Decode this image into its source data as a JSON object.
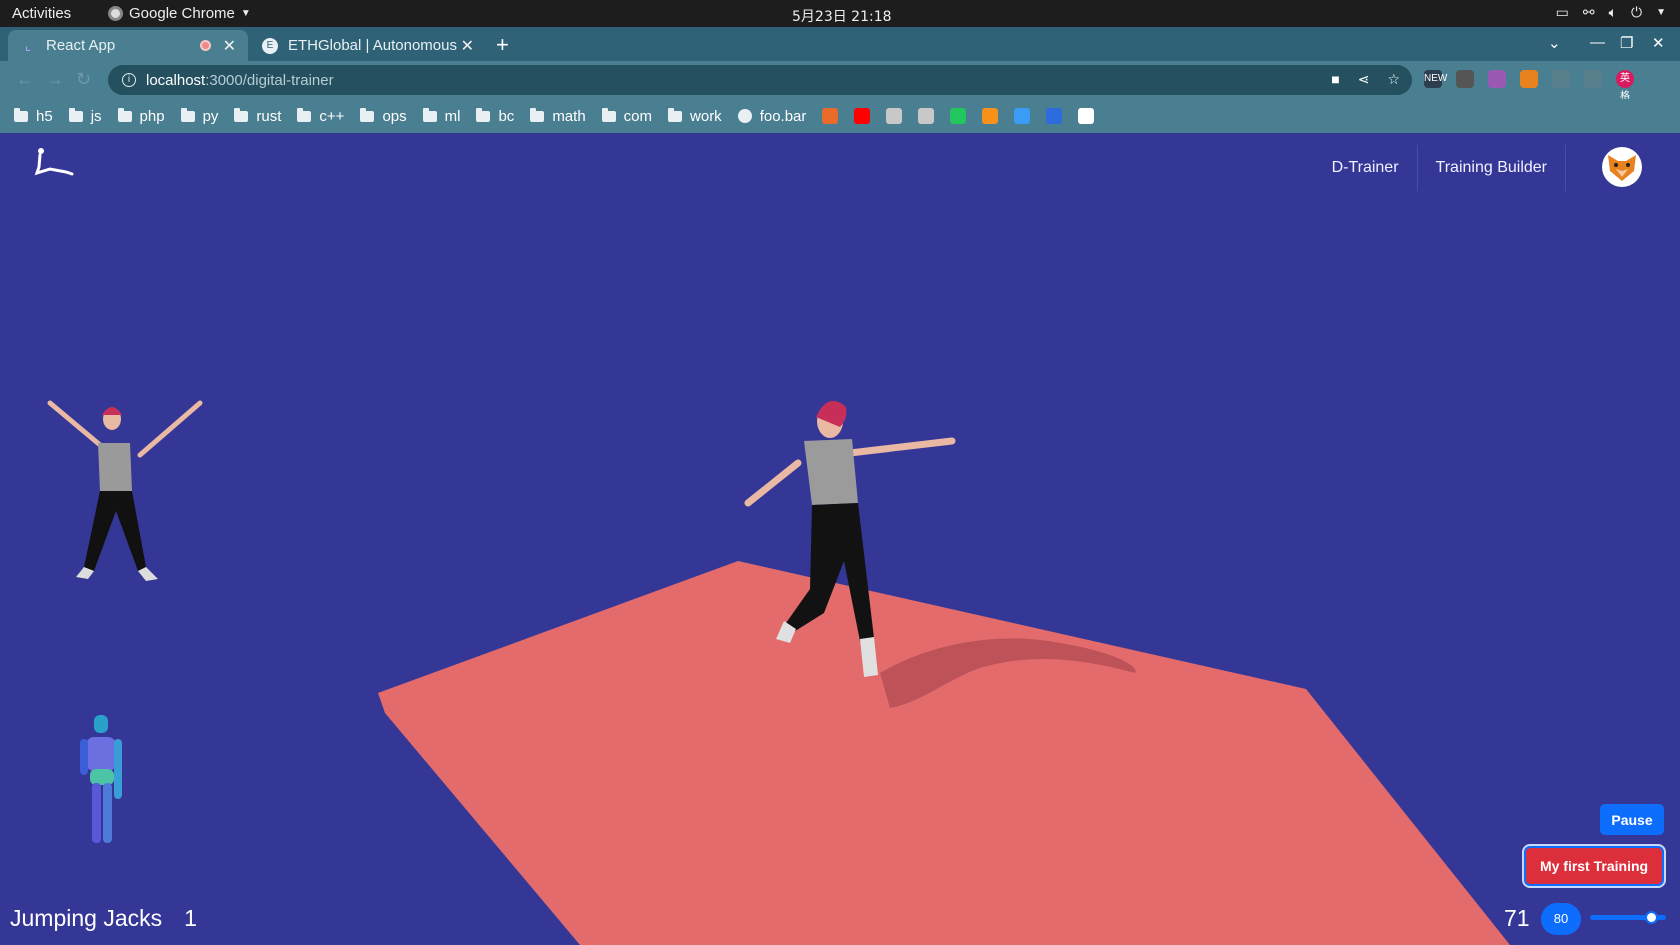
{
  "os_bar": {
    "activities": "Activities",
    "app_menu": "Google Chrome",
    "clock": "5月23日 21:18"
  },
  "tabs": [
    {
      "title": "React App",
      "active": true,
      "recording": true
    },
    {
      "title": "ETHGlobal | Autonomous",
      "active": false,
      "recording": false
    }
  ],
  "address_bar": {
    "host": "localhost",
    "path": ":3000/digital-trainer"
  },
  "bookmarks": [
    {
      "label": "h5",
      "type": "folder"
    },
    {
      "label": "js",
      "type": "folder"
    },
    {
      "label": "php",
      "type": "folder"
    },
    {
      "label": "py",
      "type": "folder"
    },
    {
      "label": "rust",
      "type": "folder"
    },
    {
      "label": "c++",
      "type": "folder"
    },
    {
      "label": "ops",
      "type": "folder"
    },
    {
      "label": "ml",
      "type": "folder"
    },
    {
      "label": "bc",
      "type": "folder"
    },
    {
      "label": "math",
      "type": "folder"
    },
    {
      "label": "com",
      "type": "folder"
    },
    {
      "label": "work",
      "type": "folder"
    },
    {
      "label": "foo.bar",
      "type": "site"
    }
  ],
  "bookmark_icons": [
    {
      "name": "arc-icon",
      "color": "#e96b2a"
    },
    {
      "name": "youtube-icon",
      "color": "#ff0000"
    },
    {
      "name": "eye-icon",
      "color": "#c8c8c8"
    },
    {
      "name": "eye-icon-2",
      "color": "#c8c8c8"
    },
    {
      "name": "play-store-icon",
      "color": "#22c55e"
    },
    {
      "name": "bitcoin-icon",
      "color": "#f7931a"
    },
    {
      "name": "k-icon",
      "color": "#3b9cf5"
    },
    {
      "name": "paw-icon",
      "color": "#2d6cdf"
    },
    {
      "name": "google-icon",
      "color": "#ffffff"
    }
  ],
  "extension_icons": [
    {
      "name": "new-extension-icon",
      "label": "NEW",
      "color": "#2c3e50"
    },
    {
      "name": "glasses-extension-icon",
      "label": "",
      "color": "#555555"
    },
    {
      "name": "color-wheel-extension-icon",
      "label": "",
      "color": "#9b59b6"
    },
    {
      "name": "metamask-extension-icon",
      "label": "",
      "color": "#e8821e"
    },
    {
      "name": "gray-extension-icon",
      "label": "",
      "color": "#5a7f8c"
    },
    {
      "name": "puzzle-extension-icon",
      "label": "",
      "color": "#5a7f8c"
    },
    {
      "name": "profile-extension-icon",
      "label": "英格",
      "color": "#d81b60"
    }
  ],
  "app": {
    "nav": {
      "d_trainer": "D-Trainer",
      "training_builder": "Training Builder"
    },
    "exercise_name": "Jumping Jacks",
    "exercise_count": "1",
    "fps": "71",
    "slider_value": 80,
    "slider_max": 100,
    "pause_label": "Pause",
    "training_label": "My first Training",
    "colors": {
      "background": "#353797",
      "floor": "#e36b6c",
      "pause": "#0d6efd",
      "training": "#dc2f3b"
    }
  }
}
